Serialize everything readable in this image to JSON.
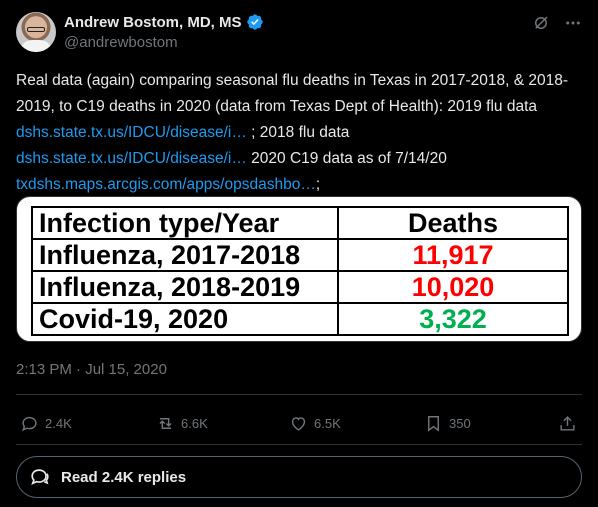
{
  "author": {
    "display_name": "Andrew Bostom, MD, MS",
    "handle": "@andrewbostom",
    "verified": true
  },
  "tweet": {
    "text_parts": [
      "Real data (again) comparing seasonal flu deaths in Texas in 2017-2018, & 2018-2019, to C19 deaths in 2020 (data from Texas Dept of Health): 2019 flu data ",
      " ; 2018 flu data ",
      " 2020 C19 data as of 7/14/20 ",
      ";"
    ],
    "links": [
      "dshs.state.tx.us/IDCU/disease/i…",
      "dshs.state.tx.us/IDCU/disease/i…",
      "txdshs.maps.arcgis.com/apps/opsdashbo…"
    ],
    "timestamp": "2:13 PM · Jul 15, 2020"
  },
  "media_table": {
    "headers": [
      "Infection type/Year",
      "Deaths"
    ],
    "rows": [
      {
        "label": "Influenza, 2017-2018",
        "value": "11,917",
        "color": "#ff0000"
      },
      {
        "label": "Influenza, 2018-2019",
        "value": "10,020",
        "color": "#ff0000"
      },
      {
        "label": "Covid-19, 2020",
        "value": "3,322",
        "color": "#00b050"
      }
    ]
  },
  "actions": {
    "replies": "2.4K",
    "reposts": "6.6K",
    "likes": "6.5K",
    "bookmarks": "350"
  },
  "read_replies_label": "Read 2.4K replies",
  "icons": {
    "verified": "verified-badge-icon",
    "grok": "grok-icon",
    "more": "more-icon"
  },
  "colors": {
    "link": "#1d9bf0",
    "muted": "#71767b",
    "verified": "#1d9bf0"
  }
}
